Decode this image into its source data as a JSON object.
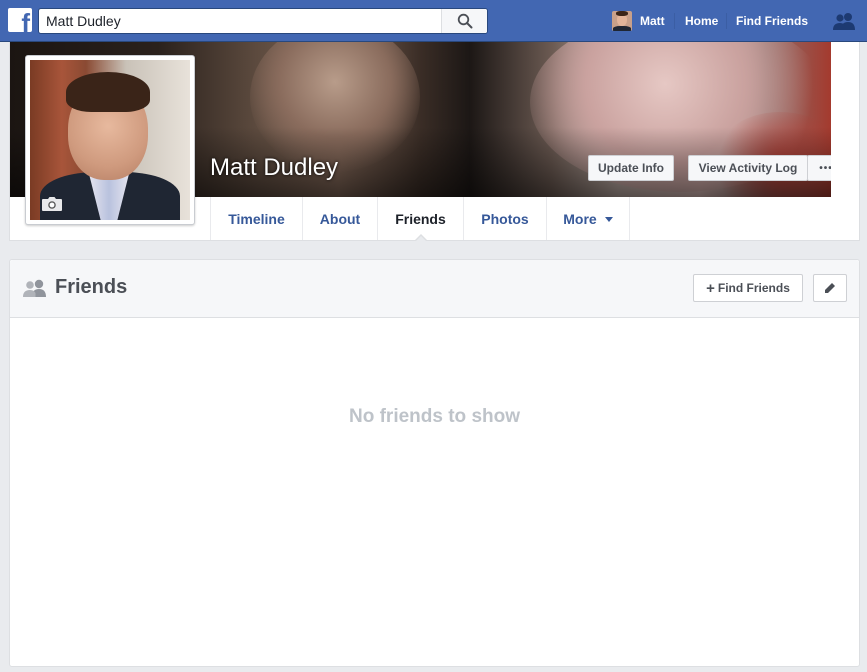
{
  "topbar": {
    "logo_letter": "f",
    "search_value": "Matt Dudley",
    "user_name": "Matt",
    "home_label": "Home",
    "find_friends_label": "Find Friends",
    "brand_color": "#4267b2"
  },
  "profile": {
    "name": "Matt Dudley",
    "update_info_label": "Update Info",
    "activity_log_label": "View Activity Log",
    "more_dots": "•••"
  },
  "tabs": [
    {
      "label": "Timeline",
      "active": false
    },
    {
      "label": "About",
      "active": false
    },
    {
      "label": "Friends",
      "active": true
    },
    {
      "label": "Photos",
      "active": false
    },
    {
      "label": "More",
      "active": false
    }
  ],
  "friends_section": {
    "title": "Friends",
    "find_friends_label": "Find Friends",
    "empty_message": "No friends to show"
  },
  "icons": [
    "facebook-logo-icon",
    "search-icon",
    "friend-requests-icon",
    "camera-icon",
    "friends-icon",
    "plus-icon",
    "pencil-icon",
    "caret-down-icon"
  ]
}
